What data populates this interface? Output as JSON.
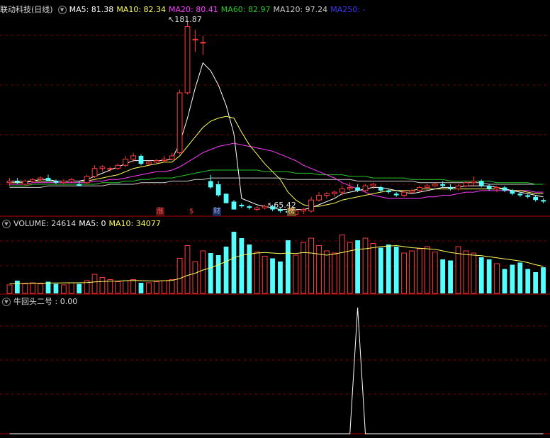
{
  "main": {
    "title": "联动科技(日线)",
    "ma5": "MA5: 81.38",
    "ma10": "MA10: 82.34",
    "ma20": "MA20: 80.41",
    "ma60": "MA60: 82.97",
    "ma120": "MA120: 97.24",
    "ma250": "MA250: -",
    "high_label": "181.87",
    "low_label": "65.42",
    "tags": [
      "涨",
      "$",
      "财",
      "榜"
    ]
  },
  "volume": {
    "vol": "VOLUME: 24614",
    "ma5": "MA5: 0",
    "ma10": "MA10: 34077"
  },
  "indicator": {
    "label": "牛回头二号 : 0.00"
  },
  "colors": {
    "up": "#ff3d3d",
    "down": "#54ffff",
    "ma5": "#ffffff",
    "ma10": "#ffff5a",
    "ma20": "#ff3cff",
    "ma60": "#28c828",
    "ma120": "#cccccc",
    "ma250": "#2a2aff",
    "grid": "#8b0000"
  },
  "chart_data": [
    {
      "type": "candlestick",
      "title": "联动科技(日线)",
      "price_range": [
        60,
        185
      ],
      "candles": [
        {
          "o": 79,
          "h": 82,
          "l": 77,
          "c": 80
        },
        {
          "o": 80,
          "h": 82,
          "l": 78,
          "c": 79
        },
        {
          "o": 78,
          "h": 81,
          "l": 77,
          "c": 80
        },
        {
          "o": 80,
          "h": 82,
          "l": 79,
          "c": 81
        },
        {
          "o": 81,
          "h": 83,
          "l": 80,
          "c": 82
        },
        {
          "o": 82,
          "h": 84,
          "l": 81,
          "c": 80
        },
        {
          "o": 80,
          "h": 81,
          "l": 78,
          "c": 79
        },
        {
          "o": 79,
          "h": 81,
          "l": 78,
          "c": 80
        },
        {
          "o": 80,
          "h": 82,
          "l": 79,
          "c": 81
        },
        {
          "o": 78,
          "h": 80,
          "l": 77,
          "c": 77
        },
        {
          "o": 79,
          "h": 84,
          "l": 78,
          "c": 83
        },
        {
          "o": 83,
          "h": 90,
          "l": 82,
          "c": 88
        },
        {
          "o": 88,
          "h": 90,
          "l": 86,
          "c": 89
        },
        {
          "o": 88,
          "h": 89,
          "l": 86,
          "c": 88
        },
        {
          "o": 88,
          "h": 91,
          "l": 87,
          "c": 90
        },
        {
          "o": 90,
          "h": 96,
          "l": 89,
          "c": 94
        },
        {
          "o": 94,
          "h": 98,
          "l": 92,
          "c": 96
        },
        {
          "o": 96,
          "h": 97,
          "l": 90,
          "c": 91
        },
        {
          "o": 91,
          "h": 93,
          "l": 90,
          "c": 92
        },
        {
          "o": 92,
          "h": 94,
          "l": 91,
          "c": 93
        },
        {
          "o": 93,
          "h": 96,
          "l": 92,
          "c": 94
        },
        {
          "o": 94,
          "h": 98,
          "l": 93,
          "c": 96
        },
        {
          "o": 98,
          "h": 138,
          "l": 97,
          "c": 136
        },
        {
          "o": 136,
          "h": 181.87,
          "l": 135,
          "c": 178
        },
        {
          "o": 170,
          "h": 176,
          "l": 162,
          "c": 170
        },
        {
          "o": 168,
          "h": 172,
          "l": 160,
          "c": 168
        },
        {
          "o": 80,
          "h": 84,
          "l": 75,
          "c": 76
        },
        {
          "o": 78,
          "h": 80,
          "l": 70,
          "c": 71
        },
        {
          "o": 72,
          "h": 72,
          "l": 66,
          "c": 66
        },
        {
          "o": 67,
          "h": 68,
          "l": 62,
          "c": 62
        },
        {
          "o": 65,
          "h": 66,
          "l": 63,
          "c": 64
        },
        {
          "o": 64,
          "h": 65,
          "l": 62,
          "c": 63
        },
        {
          "o": 62,
          "h": 64,
          "l": 61,
          "c": 63
        },
        {
          "o": 63,
          "h": 65,
          "l": 62,
          "c": 64
        },
        {
          "o": 64,
          "h": 65,
          "l": 61,
          "c": 62
        },
        {
          "o": 62,
          "h": 63,
          "l": 60,
          "c": 61
        },
        {
          "o": 61,
          "h": 62,
          "l": 59,
          "c": 60
        },
        {
          "o": 59,
          "h": 62,
          "l": 58,
          "c": 61
        },
        {
          "o": 61,
          "h": 63,
          "l": 59,
          "c": 62
        },
        {
          "o": 61,
          "h": 70,
          "l": 60,
          "c": 68
        },
        {
          "o": 68,
          "h": 73,
          "l": 67,
          "c": 71
        },
        {
          "o": 71,
          "h": 73,
          "l": 69,
          "c": 72
        },
        {
          "o": 72,
          "h": 74,
          "l": 70,
          "c": 73
        },
        {
          "o": 73,
          "h": 77,
          "l": 71,
          "c": 75
        },
        {
          "o": 75,
          "h": 79,
          "l": 74,
          "c": 76
        },
        {
          "o": 76,
          "h": 78,
          "l": 73,
          "c": 74
        },
        {
          "o": 74,
          "h": 78,
          "l": 73,
          "c": 77
        },
        {
          "o": 77,
          "h": 79,
          "l": 75,
          "c": 78
        },
        {
          "o": 76,
          "h": 77,
          "l": 73,
          "c": 74
        },
        {
          "o": 74,
          "h": 75,
          "l": 72,
          "c": 73
        },
        {
          "o": 72,
          "h": 73,
          "l": 70,
          "c": 71
        },
        {
          "o": 71,
          "h": 74,
          "l": 70,
          "c": 73
        },
        {
          "o": 73,
          "h": 75,
          "l": 72,
          "c": 74
        },
        {
          "o": 74,
          "h": 77,
          "l": 73,
          "c": 76
        },
        {
          "o": 76,
          "h": 78,
          "l": 74,
          "c": 77
        },
        {
          "o": 77,
          "h": 79,
          "l": 76,
          "c": 78
        },
        {
          "o": 78,
          "h": 80,
          "l": 76,
          "c": 77
        },
        {
          "o": 76,
          "h": 78,
          "l": 74,
          "c": 75
        },
        {
          "o": 75,
          "h": 78,
          "l": 74,
          "c": 77
        },
        {
          "o": 77,
          "h": 80,
          "l": 76,
          "c": 79
        },
        {
          "o": 79,
          "h": 83,
          "l": 77,
          "c": 80
        },
        {
          "o": 80,
          "h": 81,
          "l": 76,
          "c": 77
        },
        {
          "o": 77,
          "h": 78,
          "l": 74,
          "c": 75
        },
        {
          "o": 75,
          "h": 77,
          "l": 73,
          "c": 76
        },
        {
          "o": 76,
          "h": 77,
          "l": 73,
          "c": 74
        },
        {
          "o": 74,
          "h": 75,
          "l": 71,
          "c": 72
        },
        {
          "o": 72,
          "h": 73,
          "l": 70,
          "c": 71
        },
        {
          "o": 71,
          "h": 72,
          "l": 69,
          "c": 70
        },
        {
          "o": 70,
          "h": 71,
          "l": 67,
          "c": 68
        },
        {
          "o": 68,
          "h": 69,
          "l": 66,
          "c": 67
        }
      ],
      "ma5": [
        80,
        80,
        80,
        80,
        81,
        81,
        80,
        80,
        80,
        80,
        81,
        83,
        85,
        87,
        89,
        91,
        93,
        93,
        93,
        93,
        93,
        94,
        104,
        120,
        139,
        155,
        150,
        141,
        128,
        110,
        69,
        67,
        65,
        64,
        63,
        62,
        62,
        62,
        62,
        63,
        65,
        67,
        69,
        72,
        73,
        74,
        75,
        76,
        76,
        75,
        74,
        73,
        72,
        73,
        74,
        75,
        76,
        76,
        76,
        77,
        77,
        77,
        77,
        76,
        75,
        74,
        73,
        72,
        71,
        70
      ],
      "ma10": [
        79,
        79,
        79,
        80,
        80,
        80,
        80,
        80,
        80,
        80,
        80,
        81,
        82,
        83,
        84,
        86,
        88,
        89,
        90,
        91,
        92,
        92,
        96,
        102,
        108,
        114,
        118,
        120,
        121,
        120,
        111,
        103,
        97,
        91,
        86,
        81,
        73,
        68,
        65,
        64,
        64,
        65,
        66,
        68,
        69,
        70,
        71,
        72,
        73,
        74,
        74,
        74,
        74,
        75,
        75,
        75,
        75,
        75,
        75,
        75,
        75,
        75,
        75,
        75,
        75,
        74,
        74,
        73,
        72,
        72
      ],
      "ma20": [
        78,
        78,
        78,
        79,
        79,
        79,
        79,
        79,
        79,
        79,
        79,
        80,
        80,
        81,
        81,
        82,
        83,
        84,
        85,
        86,
        86,
        87,
        89,
        92,
        95,
        98,
        100,
        102,
        103,
        104,
        103,
        102,
        101,
        100,
        99,
        97,
        95,
        93,
        90,
        88,
        86,
        84,
        82,
        79,
        77,
        75,
        73,
        71,
        70,
        69,
        69,
        69,
        69,
        69,
        70,
        70,
        71,
        71,
        72,
        73,
        73,
        74,
        74,
        74,
        74,
        74,
        74,
        74,
        73,
        73
      ],
      "ma60": [
        77,
        77,
        77,
        78,
        78,
        78,
        78,
        78,
        78,
        78,
        78,
        78,
        79,
        79,
        79,
        80,
        80,
        81,
        81,
        82,
        82,
        82,
        83,
        84,
        85,
        86,
        87,
        87,
        87,
        87,
        87,
        87,
        87,
        86,
        86,
        86,
        86,
        85,
        85,
        85,
        84,
        84,
        84,
        84,
        83,
        83,
        83,
        82,
        82,
        82,
        82,
        82,
        81,
        81,
        81,
        81,
        81,
        80,
        80,
        80,
        80,
        80,
        80,
        79,
        79,
        79,
        79,
        79,
        78,
        78
      ],
      "ma120": [
        76,
        76,
        76,
        76,
        76,
        77,
        77,
        77,
        77,
        77,
        77,
        77,
        77,
        78,
        78,
        78,
        78,
        79,
        79,
        79,
        79,
        80,
        80,
        80,
        81,
        81,
        82,
        82,
        82,
        82,
        82,
        82,
        82,
        82,
        82,
        82,
        81,
        81,
        81,
        81,
        81,
        81,
        81,
        81,
        81,
        80,
        80,
        80,
        80,
        80,
        80,
        80,
        80,
        79,
        79,
        79,
        79,
        79,
        79,
        79,
        79,
        79,
        78,
        78,
        78,
        78,
        78,
        78,
        78,
        78
      ]
    },
    {
      "type": "bar",
      "title": "VOLUME",
      "range": [
        0,
        60000
      ],
      "values": [
        8000,
        12000,
        9000,
        10000,
        9000,
        11000,
        9000,
        8000,
        10000,
        9000,
        12000,
        18000,
        15000,
        13000,
        11000,
        12000,
        13000,
        10000,
        10000,
        11000,
        12000,
        13000,
        33000,
        45000,
        30000,
        40000,
        38000,
        36000,
        44000,
        58000,
        52000,
        46000,
        39000,
        35000,
        33000,
        30000,
        50000,
        36000,
        48000,
        52000,
        45000,
        40000,
        38000,
        55000,
        48000,
        50000,
        52000,
        47000,
        43000,
        46000,
        44000,
        38000,
        40000,
        42000,
        44000,
        39000,
        32000,
        31000,
        44000,
        40000,
        38000,
        34000,
        32000,
        28000,
        23000,
        27000,
        29000,
        23000,
        20000,
        24614
      ],
      "ma10": [
        9000,
        9000,
        9500,
        9500,
        9600,
        9700,
        9800,
        9900,
        10000,
        10000,
        10200,
        10800,
        11200,
        11500,
        11600,
        12000,
        12200,
        12000,
        11800,
        11700,
        12000,
        12300,
        14000,
        17000,
        19000,
        22000,
        24000,
        27000,
        30000,
        33500,
        36000,
        37000,
        38000,
        38500,
        38000,
        37500,
        38000,
        37500,
        38500,
        38000,
        37000,
        36000,
        37000,
        38500,
        40000,
        41500,
        42000,
        43000,
        44000,
        44500,
        45000,
        44000,
        43000,
        42500,
        42000,
        41500,
        40000,
        38500,
        37500,
        36500,
        36000,
        35500,
        34500,
        33500,
        32500,
        31500,
        30500,
        29000,
        27000,
        25500
      ]
    },
    {
      "type": "line",
      "title": "牛回头二号",
      "range": [
        0,
        1
      ],
      "values": [
        0,
        0,
        0,
        0,
        0,
        0,
        0,
        0,
        0,
        0,
        0,
        0,
        0,
        0,
        0,
        0,
        0,
        0,
        0,
        0,
        0,
        0,
        0,
        0,
        0,
        0,
        0,
        0,
        0,
        0,
        0,
        0,
        0,
        0,
        0,
        0,
        0,
        0,
        0,
        0,
        0,
        0,
        0,
        0,
        0,
        1,
        0,
        0,
        0,
        0,
        0,
        0,
        0,
        0,
        0,
        0,
        0,
        0,
        0,
        0,
        0,
        0,
        0,
        0,
        0,
        0,
        0,
        0,
        0,
        0
      ]
    }
  ]
}
